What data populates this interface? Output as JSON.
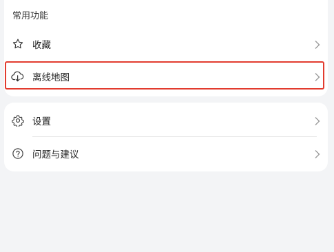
{
  "section": {
    "title": "常用功能"
  },
  "common_items": [
    {
      "label": "收藏",
      "icon": "star-icon"
    },
    {
      "label": "离线地图",
      "icon": "cloud-download-icon"
    }
  ],
  "other_items": [
    {
      "label": "设置",
      "icon": "gear-icon"
    },
    {
      "label": "问题与建议",
      "icon": "question-circle-icon"
    }
  ],
  "colors": {
    "page_bg": "#f3f4f6",
    "card_bg": "#ffffff",
    "highlight_border": "#e23b2e",
    "chevron": "#9a9a9a"
  }
}
